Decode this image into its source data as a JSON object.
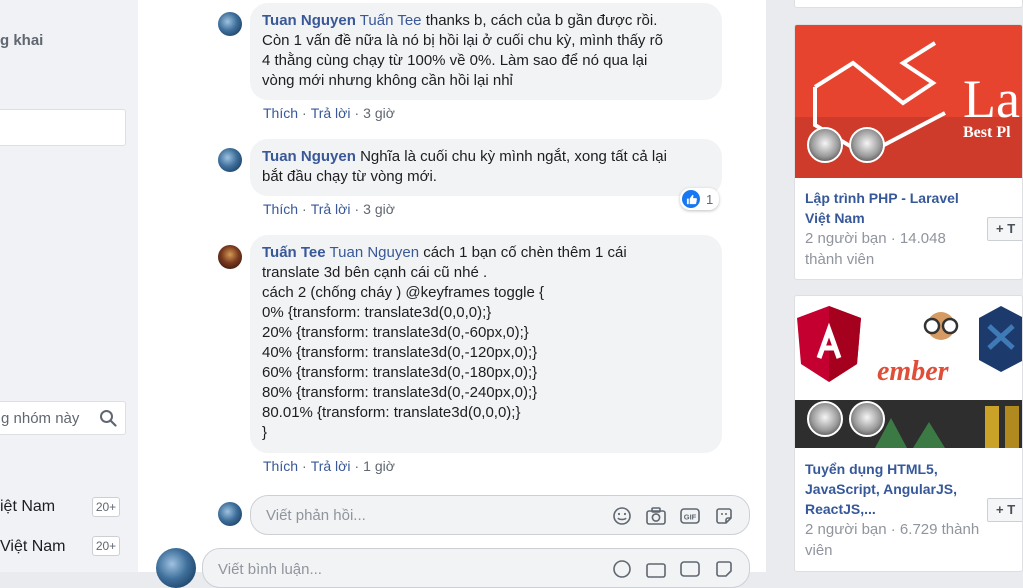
{
  "left": {
    "fragment_title": "g khai",
    "search_placeholder": "g nhóm này",
    "groups": [
      {
        "label": "iệt Nam",
        "badge": "20+"
      },
      {
        "label": "Việt Nam",
        "badge": "20+"
      }
    ]
  },
  "comments": [
    {
      "author": "Tuan Nguyen",
      "mention": "Tuấn Tee",
      "lines": [
        "thanks b, cách của b gần được rồi.",
        "Còn 1 vấn đề nữa là nó bị hồi lại ở cuối chu kỳ, mình thấy rõ",
        "4 thằng cùng chạy từ 100% về 0%. Làm sao để nó qua lại",
        "vòng mới nhưng không cần hồi lại nhỉ"
      ],
      "like": "Thích",
      "reply": "Trả lời",
      "time": "3 giờ"
    },
    {
      "author": "Tuan Nguyen",
      "mention": "",
      "lines": [
        "Nghĩa là cuối chu kỳ mình ngắt, xong tất cả lại",
        "bắt đầu chạy từ vòng mới."
      ],
      "like": "Thích",
      "reply": "Trả lời",
      "time": "3 giờ",
      "reactions": "1"
    },
    {
      "author": "Tuấn Tee",
      "mention": "Tuan Nguyen",
      "lines": [
        "cách 1 bạn cố chèn thêm 1 cái",
        "translate 3d bên cạnh cái cũ nhé .",
        "cách 2 (chống cháy ) @keyframes toggle {",
        "0% {transform: translate3d(0,0,0);}",
        "20% {transform: translate3d(0,-60px,0);}",
        "40% {transform: translate3d(0,-120px,0);}",
        "60% {transform: translate3d(0,-180px,0);}",
        "80% {transform: translate3d(0,-240px,0);}",
        "80.01% {transform: translate3d(0,0,0);}",
        "}"
      ],
      "like": "Thích",
      "reply": "Trả lời",
      "time": "1 giờ"
    }
  ],
  "reply_placeholder": "Viết phản hồi...",
  "comment_placeholder": "Viết bình luận...",
  "suggestions": [
    {
      "title": "Lập trình PHP - Laravel Việt Nam",
      "meta": "2 người bạn · 14.048 thành viên",
      "join": "+ T",
      "banner_text": "La",
      "banner_sub": "Best Pl"
    },
    {
      "title": "Tuyển dụng HTML5, JavaScript, AngularJS, ReactJS,...",
      "meta": "2 người bạn · 6.729 thành viên",
      "join": "+ T",
      "banner_text": "ember"
    }
  ],
  "colors": {
    "link": "#385898",
    "bubble": "#f2f3f5",
    "like_blue": "#1877f2",
    "laravel_red": "#e74430"
  }
}
